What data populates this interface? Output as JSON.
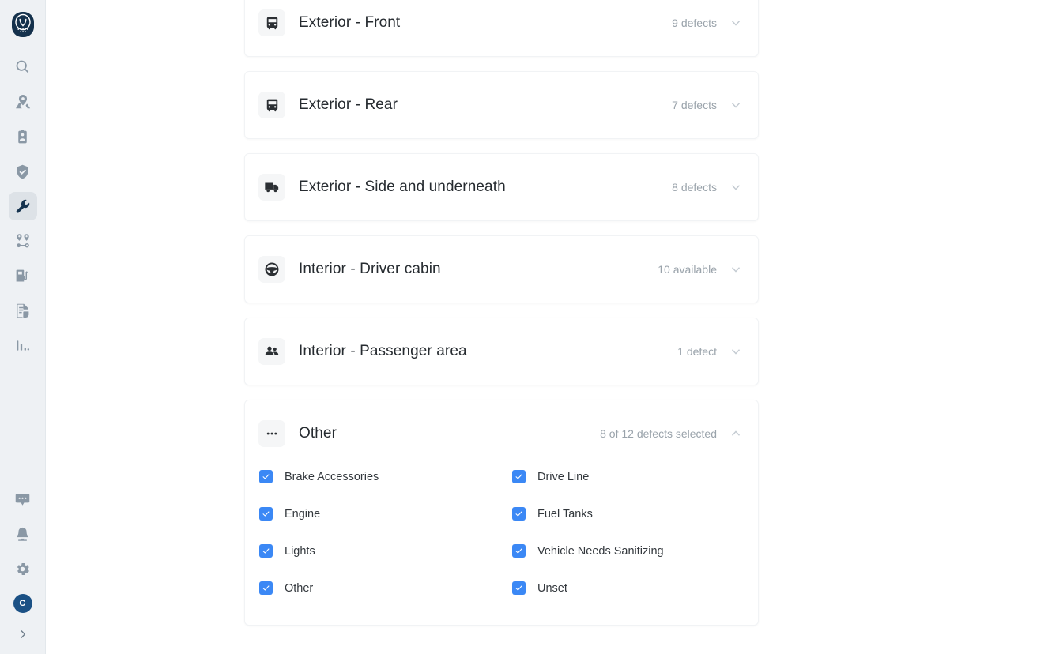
{
  "sidebar": {
    "logo": {
      "name": "app-logo",
      "alt": "owl-logo"
    },
    "nav_top": [
      {
        "icon": "search-icon",
        "name": "search"
      },
      {
        "icon": "map-pin-icon",
        "name": "map"
      },
      {
        "icon": "id-badge-icon",
        "name": "drivers"
      },
      {
        "icon": "shield-icon",
        "name": "safety"
      },
      {
        "icon": "wrench-icon",
        "name": "maintenance",
        "active": true
      },
      {
        "icon": "route-icon",
        "name": "routes"
      },
      {
        "icon": "fuel-pump-icon",
        "name": "fuel"
      },
      {
        "icon": "document-icon",
        "name": "documents"
      },
      {
        "icon": "bar-chart-icon",
        "name": "reports"
      }
    ],
    "nav_bottom": [
      {
        "icon": "chat-icon",
        "name": "messages"
      },
      {
        "icon": "bell-icon",
        "name": "notifications"
      },
      {
        "icon": "gear-icon",
        "name": "settings"
      }
    ],
    "avatar_initial": "C",
    "collapse_icon": "chevron-right-icon"
  },
  "cards": [
    {
      "id": "exterior-front",
      "icon": "bus-front-icon",
      "title": "Exterior - Front",
      "meta": "9 defects",
      "expanded": false
    },
    {
      "id": "exterior-rear",
      "icon": "bus-front-icon",
      "title": "Exterior - Rear",
      "meta": "7 defects",
      "expanded": false
    },
    {
      "id": "exterior-side-underneath",
      "icon": "truck-side-icon",
      "title": "Exterior - Side and underneath",
      "meta": "8 defects",
      "expanded": false
    },
    {
      "id": "interior-driver-cabin",
      "icon": "steering-wheel-icon",
      "title": "Interior - Driver cabin",
      "meta": "10 available",
      "expanded": false
    },
    {
      "id": "interior-passenger-area",
      "icon": "people-icon",
      "title": "Interior - Passenger area",
      "meta": "1 defect",
      "expanded": false
    },
    {
      "id": "other",
      "icon": "ellipsis-icon",
      "title": "Other",
      "meta": "8 of 12 defects selected",
      "expanded": true,
      "options": [
        {
          "label": "Brake Accessories",
          "checked": true
        },
        {
          "label": "Drive Line",
          "checked": true
        },
        {
          "label": "Engine",
          "checked": true
        },
        {
          "label": "Fuel Tanks",
          "checked": true
        },
        {
          "label": "Lights",
          "checked": true
        },
        {
          "label": "Vehicle Needs Sanitizing",
          "checked": true
        },
        {
          "label": "Other",
          "checked": true
        },
        {
          "label": "Unset",
          "checked": true
        }
      ]
    }
  ],
  "colors": {
    "accent_checkbox": "#3b88f5",
    "sidebar_bg": "#eef1f4",
    "active_nav_bg": "#dde2e7",
    "logo_navy": "#14314c",
    "avatar_blue": "#1b5185",
    "meta_text": "#9aa3ab"
  }
}
